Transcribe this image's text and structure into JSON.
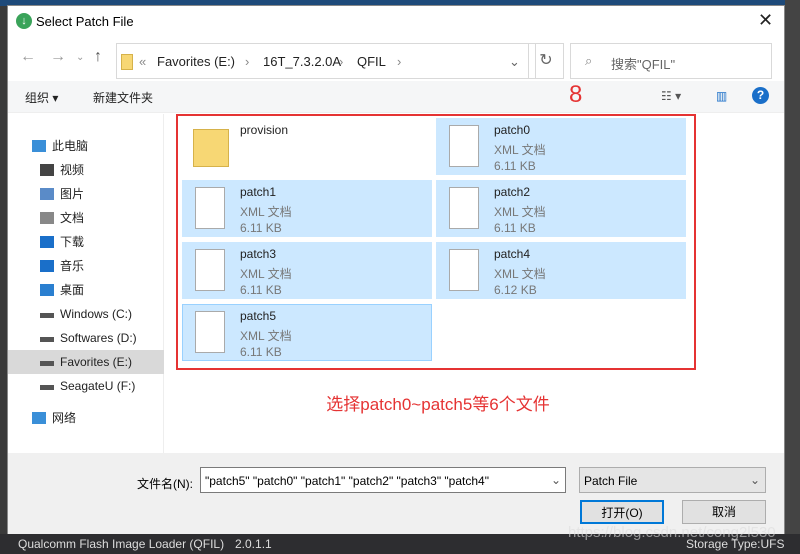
{
  "window": {
    "title": "Select Patch File"
  },
  "address": {
    "prefix": "«",
    "crumbs": [
      "Favorites (E:)",
      "16T_7.3.2.0A",
      "QFIL"
    ]
  },
  "search": {
    "placeholder": "搜索\"QFIL\""
  },
  "toolbar": {
    "organize": "组织 ▾",
    "new_folder": "新建文件夹"
  },
  "annotation": {
    "number": "8",
    "caption": "选择patch0~patch5等6个文件",
    "color": "#e53333"
  },
  "sidebar": {
    "items": [
      {
        "label": "此电脑",
        "icon": "computer-icon"
      },
      {
        "label": "视频",
        "icon": "video-icon"
      },
      {
        "label": "图片",
        "icon": "pictures-icon"
      },
      {
        "label": "文档",
        "icon": "documents-icon"
      },
      {
        "label": "下载",
        "icon": "download-icon"
      },
      {
        "label": "音乐",
        "icon": "music-icon"
      },
      {
        "label": "桌面",
        "icon": "desktop-icon"
      },
      {
        "label": "Windows (C:)",
        "icon": "drive-icon"
      },
      {
        "label": "Softwares (D:)",
        "icon": "drive-icon"
      },
      {
        "label": "Favorites (E:)",
        "icon": "drive-icon",
        "selected": true
      },
      {
        "label": "SeagateU (F:)",
        "icon": "drive-icon"
      },
      {
        "label": "网络",
        "icon": "network-icon"
      }
    ]
  },
  "files": [
    {
      "name": "provision",
      "type": "",
      "size": "",
      "kind": "folder"
    },
    {
      "name": "patch0",
      "type": "XML 文档",
      "size": "6.11 KB",
      "kind": "xml",
      "selected": true
    },
    {
      "name": "patch1",
      "type": "XML 文档",
      "size": "6.11 KB",
      "kind": "xml",
      "selected": true
    },
    {
      "name": "patch2",
      "type": "XML 文档",
      "size": "6.11 KB",
      "kind": "xml",
      "selected": true
    },
    {
      "name": "patch3",
      "type": "XML 文档",
      "size": "6.11 KB",
      "kind": "xml",
      "selected": true
    },
    {
      "name": "patch4",
      "type": "XML 文档",
      "size": "6.12 KB",
      "kind": "xml",
      "selected": true
    },
    {
      "name": "patch5",
      "type": "XML 文档",
      "size": "6.11 KB",
      "kind": "xml",
      "selected": true
    }
  ],
  "footer": {
    "filename_label": "文件名(N):",
    "filename_value": "\"patch5\" \"patch0\" \"patch1\" \"patch2\" \"patch3\" \"patch4\"",
    "filter": "Patch File",
    "open": "打开(O)",
    "cancel": "取消"
  },
  "statusbar": {
    "app": "Qualcomm Flash Image Loader (QFIL)",
    "version": "2.0.1.1",
    "storage": "Storage Type:UFS",
    "watermark": "https://blog.csdn.net/cong2l530"
  }
}
